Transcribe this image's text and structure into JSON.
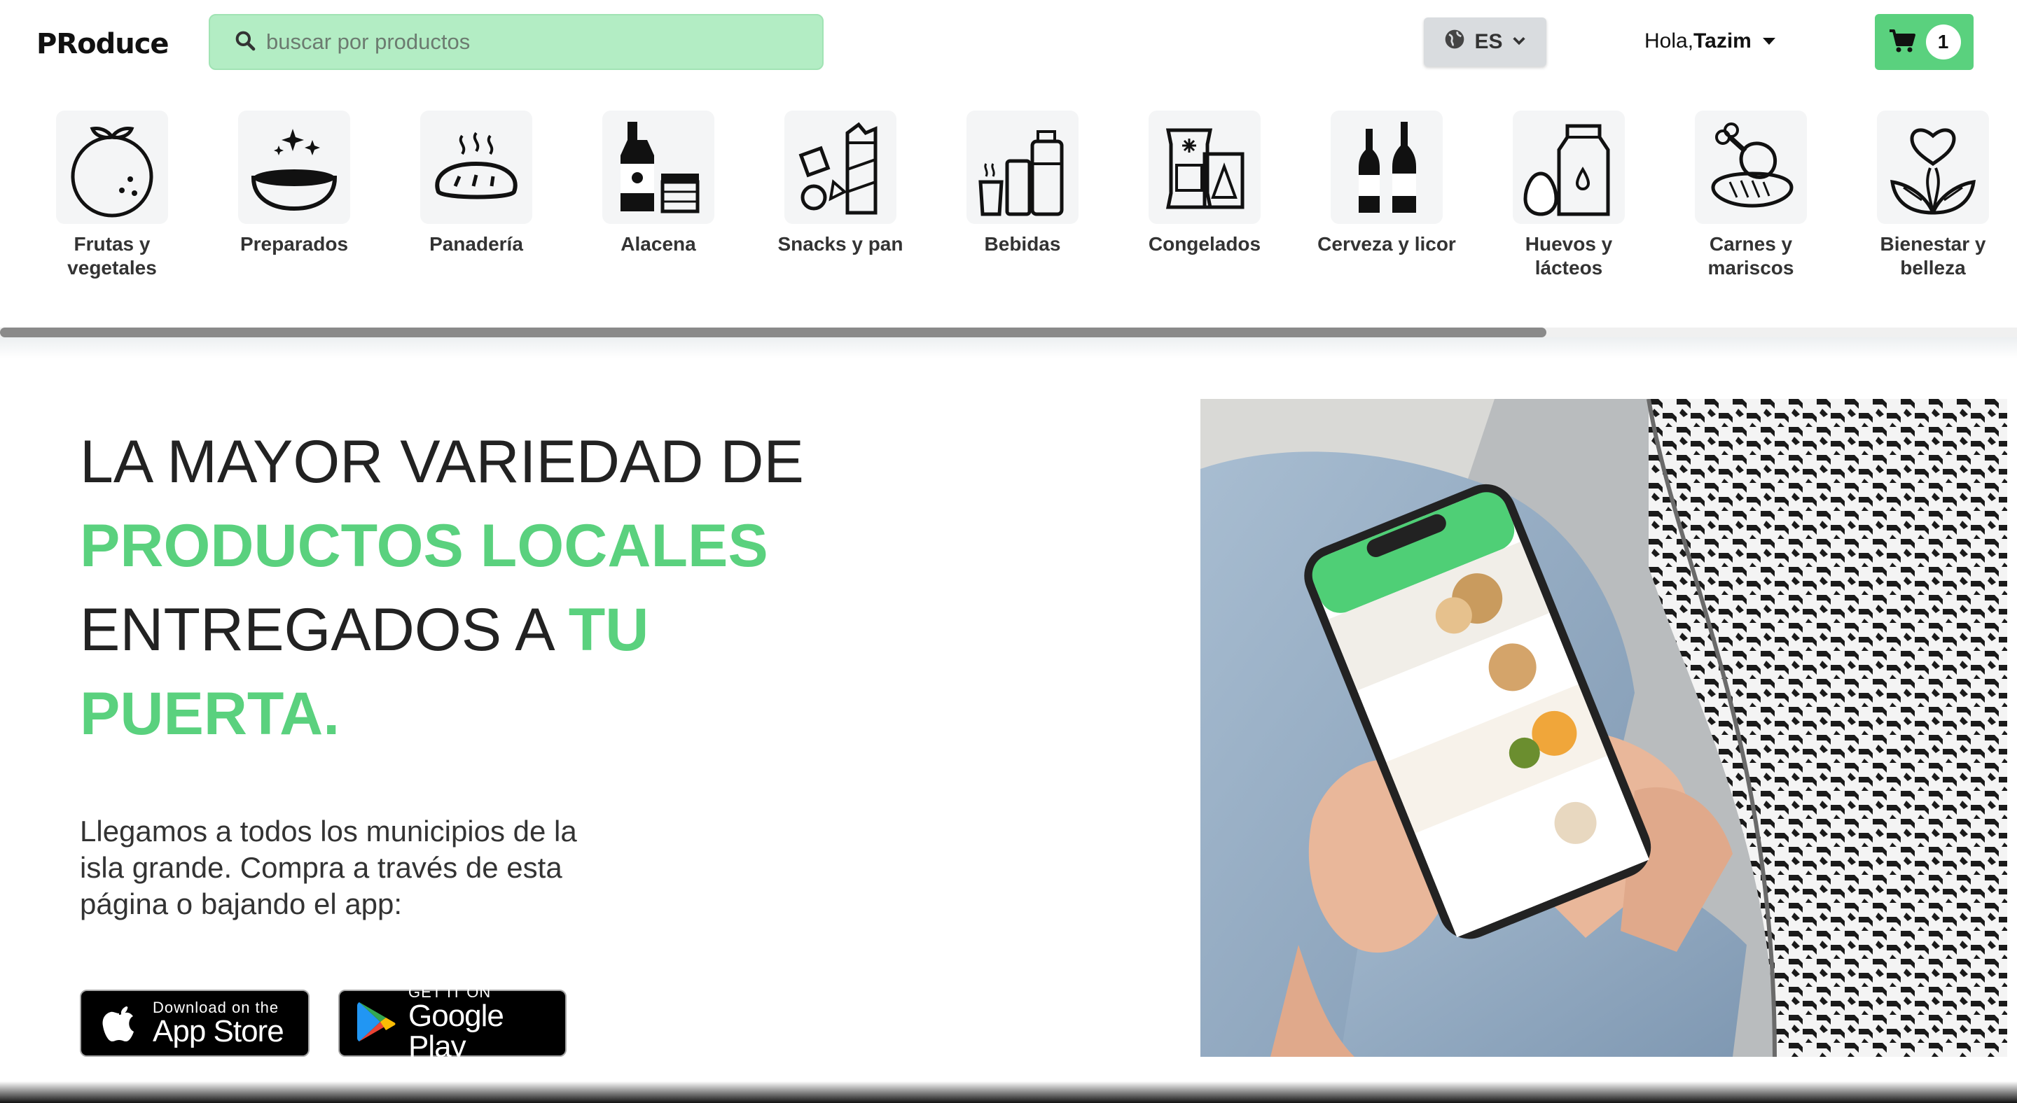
{
  "header": {
    "logo": "PRoduce",
    "search_placeholder": "buscar por productos",
    "language": "ES",
    "greeting": "Hola,",
    "user_name": "Tazim",
    "cart_count": "1"
  },
  "categories": [
    {
      "label": "Frutas y vegetales",
      "icon": "orange-icon"
    },
    {
      "label": "Preparados",
      "icon": "bowl-icon"
    },
    {
      "label": "Panadería",
      "icon": "bread-icon"
    },
    {
      "label": "Alacena",
      "icon": "bottle-jar-icon"
    },
    {
      "label": "Snacks y pan",
      "icon": "snacks-icon"
    },
    {
      "label": "Bebidas",
      "icon": "drinks-icon"
    },
    {
      "label": "Congelados",
      "icon": "frozen-icon"
    },
    {
      "label": "Cerveza y licor",
      "icon": "beer-bottles-icon"
    },
    {
      "label": "Huevos y lácteos",
      "icon": "egg-milk-icon"
    },
    {
      "label": "Carnes y mariscos",
      "icon": "meat-icon"
    },
    {
      "label": "Bienestar y belleza",
      "icon": "leaves-heart-icon"
    }
  ],
  "hero": {
    "line1": "LA MAYOR VARIEDAD DE",
    "line2_accent": "PRODUCTOS LOCALES",
    "line3": "ENTREGADOS A",
    "line3_accent": "TU",
    "line4_accent": "PUERTA.",
    "body": "Llegamos a todos los municipios de la isla grande. Compra a través de esta página o bajando el app:"
  },
  "stores": {
    "apple_small": "Download on the",
    "apple_big": "App Store",
    "google_small": "GET IT ON",
    "google_big": "Google Play"
  },
  "colors": {
    "accent": "#5ad17e",
    "search_bg": "#b3edc4",
    "text": "#222222"
  }
}
